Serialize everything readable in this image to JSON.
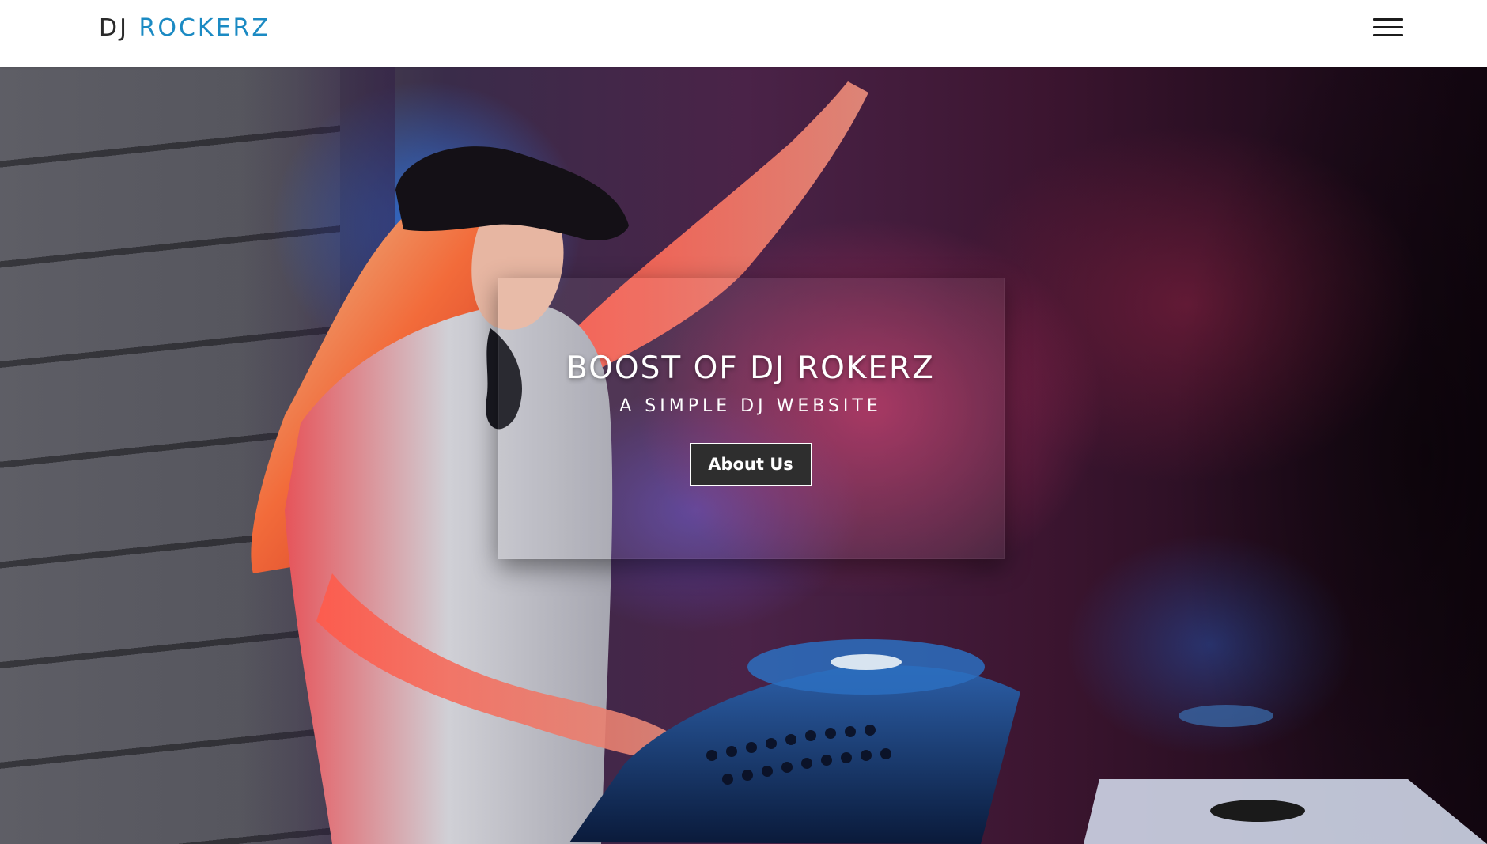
{
  "navbar": {
    "brand_part1": "DJ",
    "brand_part2": "ROCKERZ",
    "brand_color": "#1b8ac3",
    "menu_icon": "hamburger-menu-icon"
  },
  "hero": {
    "title": "BOOST OF DJ ROKERZ",
    "subtitle": "A SIMPLE DJ WEBSITE",
    "button_label": "About Us",
    "background_image": "dj-girl-at-turntables"
  }
}
